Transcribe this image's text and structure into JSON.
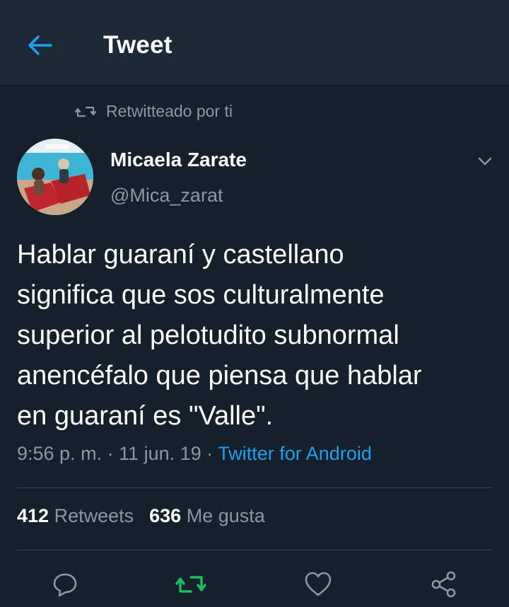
{
  "header": {
    "title": "Tweet",
    "back_icon": "back-arrow-icon"
  },
  "retweet_context": {
    "label": "Retwitteado por ti",
    "icon": "retweet-icon"
  },
  "author": {
    "name": "Micaela Zarate",
    "handle": "@Mica_zarat"
  },
  "tweet": {
    "lines": [
      "Hablar guaraní y castellano",
      "significa que sos culturalmente",
      "superior al pelotudito subnormal",
      "anencéfalo que piensa que hablar",
      "en guaraní es \"Valle\"."
    ],
    "time": "9:56 p. m.",
    "date": "11 jun. 19",
    "separator": "·",
    "source": "Twitter for Android"
  },
  "stats": {
    "retweets_count": "412",
    "retweets_label": "Retweets",
    "likes_count": "636",
    "likes_label": "Me gusta"
  },
  "colors": {
    "background": "#15202b",
    "header": "#1c2938",
    "accent": "#1da1f2",
    "secondary_text": "#8899a6",
    "retweet_active": "#17bf63"
  }
}
